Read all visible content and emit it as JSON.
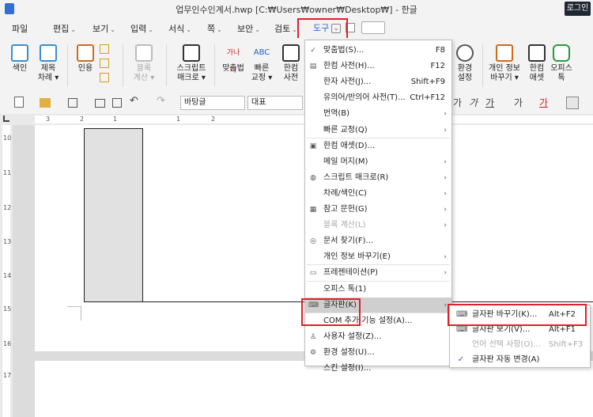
{
  "window": {
    "title": "업무인수인계서.hwp [C:₩Users₩owner₩Desktop₩] - 한글",
    "login_label": "로그인"
  },
  "menubar": {
    "items": [
      {
        "label": "파일",
        "chevron": false
      },
      {
        "label": "편집",
        "chevron": true
      },
      {
        "label": "보기",
        "chevron": true
      },
      {
        "label": "입력",
        "chevron": true
      },
      {
        "label": "서식",
        "chevron": true
      },
      {
        "label": "쪽",
        "chevron": true
      },
      {
        "label": "보안",
        "chevron": true
      },
      {
        "label": "검토",
        "chevron": true
      },
      {
        "label": "도구",
        "chevron": false
      }
    ],
    "dropdown_glyph": "⌄",
    "chevron_glyph": "⌄"
  },
  "ribbon": {
    "left_buttons": [
      {
        "label1": "색인",
        "label2": "",
        "icon": "index-icon"
      },
      {
        "label1": "제목",
        "label2": "차례 ▾",
        "icon": "toc-icon"
      },
      {
        "label1": "인용",
        "label2": "",
        "icon": "citation-icon"
      },
      {
        "label1": "블록",
        "label2": "계산 ▾",
        "icon": "block-calc-icon",
        "disabled": true
      },
      {
        "label1": "스크립트",
        "label2": "매크로 ▾",
        "icon": "script-macro-icon"
      },
      {
        "label1": "맞춤법",
        "label2": "",
        "icon": "spellcheck-icon"
      },
      {
        "label1": "빠른",
        "label2": "교정 ▾",
        "icon": "quick-correct-icon"
      },
      {
        "label1": "한컴",
        "label2": "사전",
        "icon": "dictionary-icon"
      }
    ],
    "right_buttons": [
      {
        "label1": "환경",
        "label2": "설정",
        "icon": "settings-gear-icon"
      },
      {
        "label1": "개인 정보",
        "label2": "바꾸기 ▾",
        "icon": "personal-info-icon"
      },
      {
        "label1": "한컴",
        "label2": "애셋",
        "icon": "asset-icon"
      },
      {
        "label1": "오피스",
        "label2": "톡",
        "icon": "office-talk-icon"
      }
    ],
    "spell_icon_text": "가나다",
    "abc_icon_text": "ABC"
  },
  "toolbar": {
    "style_value": "바탕글",
    "font_value": "대표",
    "char_buttons": [
      "가",
      "가",
      "가",
      "가",
      "가"
    ]
  },
  "ruler": {
    "h_numbers": [
      "3",
      "2",
      "1",
      "1",
      "2"
    ],
    "v_numbers": [
      "10",
      "11",
      "12",
      "13",
      "14",
      "15",
      "16",
      "17"
    ]
  },
  "tools_menu": {
    "items": [
      {
        "label": "맞춤법(S)...",
        "shortcut": "F8",
        "icon": "spellcheck-icon",
        "glyph": "✓"
      },
      {
        "label": "한컴 사전(H)...",
        "shortcut": "F12",
        "icon": "dictionary-icon",
        "glyph": "▤"
      },
      {
        "label": "한자 사전(J)...",
        "shortcut": "Shift+F9"
      },
      {
        "label": "유의어/반의어 사전(T)...",
        "shortcut": "Ctrl+F12"
      },
      {
        "label": "번역(B)",
        "submenu": true
      },
      {
        "label": "빠른 교정(Q)",
        "submenu": true
      },
      {
        "label": "한컴 애셋(D)...",
        "icon": "asset-icon",
        "glyph": "▣",
        "sep_before": true
      },
      {
        "label": "메일 머지(M)",
        "submenu": true
      },
      {
        "label": "스크립트 매크로(R)",
        "submenu": true,
        "icon": "script-macro-icon",
        "glyph": "◍"
      },
      {
        "label": "차례/색인(C)",
        "submenu": true
      },
      {
        "label": "참고 문헌(G)",
        "submenu": true,
        "icon": "reference-icon",
        "glyph": "▦"
      },
      {
        "label": "블록 계산(L)",
        "submenu": true,
        "disabled": true
      },
      {
        "label": "문서 찾기(F)...",
        "icon": "binoculars-icon",
        "glyph": "◎"
      },
      {
        "label": "개인 정보 바꾸기(E)",
        "submenu": true
      },
      {
        "label": "프레젠테이션(P)",
        "submenu": true,
        "icon": "presentation-icon",
        "glyph": "▭",
        "sep_before": true
      },
      {
        "label": "오피스 톡(1)",
        "sep_before": true
      },
      {
        "label": "글자판(K)",
        "submenu": true,
        "icon": "keyboard-icon",
        "glyph": "⌨",
        "highlight": true
      },
      {
        "label": "COM 추가 기능 설정(A)...",
        "sep_before": true
      },
      {
        "label": "사용자 설정(Z)...",
        "icon": "user-settings-icon",
        "glyph": "♙"
      },
      {
        "label": "환경 설정(U)...",
        "icon": "settings-gear-icon",
        "glyph": "⚙"
      },
      {
        "label": "스킨 설정(I)..."
      }
    ],
    "arrow_glyph": "›"
  },
  "keyboard_submenu": {
    "items": [
      {
        "label": "글자판 바꾸기(K)...",
        "shortcut": "Alt+F2",
        "glyph": "⌨",
        "icon": "keyboard-icon"
      },
      {
        "label": "글자판 보기(V)...",
        "shortcut": "Alt+F1",
        "glyph": "⌨",
        "icon": "keyboard-view-icon"
      },
      {
        "label": "언어 선택 사항(O)...",
        "shortcut": "Shift+F3",
        "disabled": true
      },
      {
        "label": "글자판 자동 변경(A)",
        "check": true,
        "glyph": "✓",
        "icon": "check-icon"
      }
    ]
  },
  "colors": {
    "accent": "#1f5fd6",
    "highlight_box": "#e0202a",
    "menu_highlight": "#cfcfcf"
  }
}
